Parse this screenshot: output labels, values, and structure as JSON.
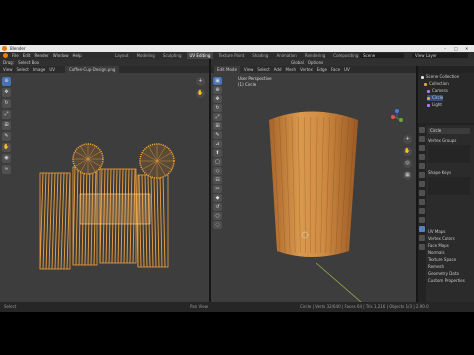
{
  "window": {
    "title": "Blender",
    "controls": [
      "–",
      "□",
      "✕"
    ]
  },
  "menu": {
    "items": [
      "File",
      "Edit",
      "Render",
      "Window",
      "Help"
    ]
  },
  "workspaces": {
    "tabs": [
      "Layout",
      "Modeling",
      "Sculpting",
      "UV Editing",
      "Texture Paint",
      "Shading",
      "Animation",
      "Rendering",
      "Compositing",
      "Scripting"
    ],
    "active_index": 3
  },
  "scene": {
    "name": "Scene",
    "view_layer": "View Layer"
  },
  "left_editor": {
    "tool_header": {
      "items": [
        "Drag:",
        "Select Box"
      ]
    },
    "header": {
      "items": [
        "View",
        "Select",
        "Image",
        "UV"
      ],
      "image_name": "Coffee-Cup-Design.png"
    }
  },
  "right_editor": {
    "tool_header": {
      "items": [
        "Global",
        "Options"
      ]
    },
    "header": {
      "items": [
        "Edit Mode",
        "View",
        "Select",
        "Add",
        "Mesh",
        "Vertex",
        "Edge",
        "Face",
        "UV"
      ]
    },
    "info": {
      "line1": "User Perspective",
      "line2": "(1) Circle"
    }
  },
  "outliner": {
    "rows": [
      {
        "label": "Scene Collection",
        "color": "#dddddd"
      },
      {
        "label": "Collection",
        "color": "#e0a43a"
      },
      {
        "label": "Camera",
        "color": "#b07be6"
      },
      {
        "label": "Circle",
        "color": "#e8a53a"
      },
      {
        "label": "Light",
        "color": "#b07be6"
      }
    ]
  },
  "properties": {
    "object_name": "Circle",
    "sections": [
      "Vertex Groups",
      "Shape Keys",
      "UV Maps",
      "Vertex Colors",
      "Face Maps",
      "Normals",
      "Texture Space",
      "Remesh",
      "Geometry Data",
      "Custom Properties"
    ]
  },
  "status": {
    "left": "Select",
    "middle": "Pan View",
    "right": "Circle | Verts 32/640 | Faces 64 | Tris 1,216 | Objects 1/3 | 2.90.0"
  },
  "colors": {
    "accent": "#4772b3",
    "mesh_orange": "#f0a13c",
    "wood": "#c9873d"
  },
  "icons": {
    "tools_left": [
      "cursor-icon",
      "move-icon",
      "rotate-icon",
      "scale-icon",
      "transform-icon",
      "annotate-icon",
      "grab-icon",
      "pinch-icon",
      "relax-icon"
    ],
    "tools_right": [
      "select-icon",
      "cursor-icon",
      "move-icon",
      "rotate-icon",
      "scale-icon",
      "transform-icon",
      "annotate-icon",
      "measure-icon",
      "extrude-icon",
      "inset-icon",
      "bevel-icon",
      "loopcut-icon",
      "knife-icon",
      "polybuild-icon",
      "spin-icon",
      "smooth-icon",
      "shrink-icon"
    ]
  }
}
